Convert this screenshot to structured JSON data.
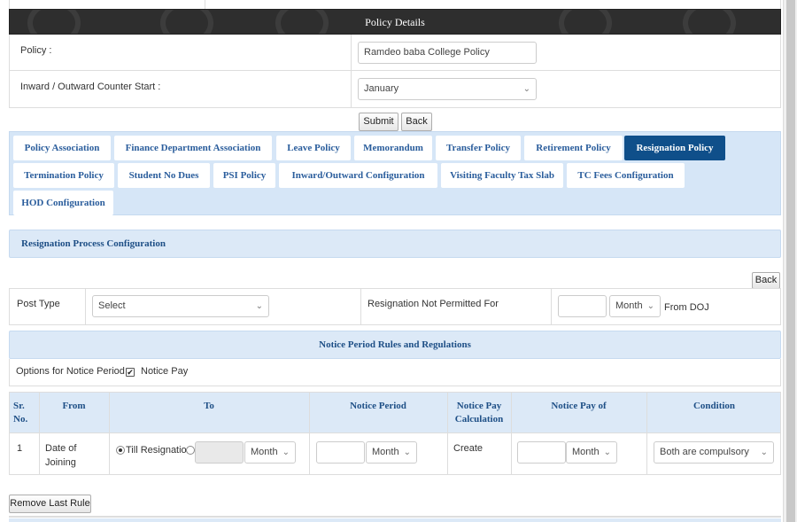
{
  "panel": {
    "title": "Policy Details"
  },
  "form": {
    "policy_label": "Policy :",
    "policy_value": "Ramdeo baba College Policy",
    "counter_label": "Inward / Outward Counter Start :",
    "counter_value": "January"
  },
  "actions": {
    "submit": "Submit",
    "back": "Back"
  },
  "tabs": [
    {
      "label": "Policy Association"
    },
    {
      "label": "Finance Department Association"
    },
    {
      "label": "Leave Policy"
    },
    {
      "label": "Memorandum"
    },
    {
      "label": "Transfer Policy"
    },
    {
      "label": "Retirement Policy"
    },
    {
      "label": "Resignation Policy",
      "active": true
    },
    {
      "label": "Termination Policy"
    },
    {
      "label": "Student No Dues"
    },
    {
      "label": "PSI Policy"
    },
    {
      "label": "Inward/Outward Configuration"
    },
    {
      "label": "Visiting Faculty Tax Slab"
    },
    {
      "label": "TC Fees Configuration"
    },
    {
      "label": "HOD Configuration"
    }
  ],
  "config": {
    "section_title": "Resignation Process Configuration",
    "back": "Back",
    "post_type_label": "Post Type",
    "post_type_value": "Select",
    "not_permitted_label": "Resignation Not Permitted For",
    "not_permitted_value": "",
    "not_permitted_unit": "Month",
    "from_doj": "From DOJ"
  },
  "notice": {
    "section_title": "Notice Period Rules and Regulations",
    "options_label": "Options for Notice Period :",
    "notice_pay_label": "Notice Pay",
    "notice_pay_checked": true
  },
  "rules": {
    "headers": {
      "sr": "Sr. No.",
      "from": "From",
      "to": "To",
      "notice_period": "Notice Period",
      "calc": "Notice Pay Calculation",
      "pay_of": "Notice Pay of",
      "condition": "Condition"
    },
    "rows": [
      {
        "sr": "1",
        "from": "Date of Joining",
        "till_label": "Till Resignation",
        "to_unit": "Month",
        "notice_unit": "Month",
        "calc_link": "Create",
        "pay_unit": "Month",
        "condition": "Both are compulsory"
      }
    ]
  },
  "remove_rule": "Remove Last Rule"
}
